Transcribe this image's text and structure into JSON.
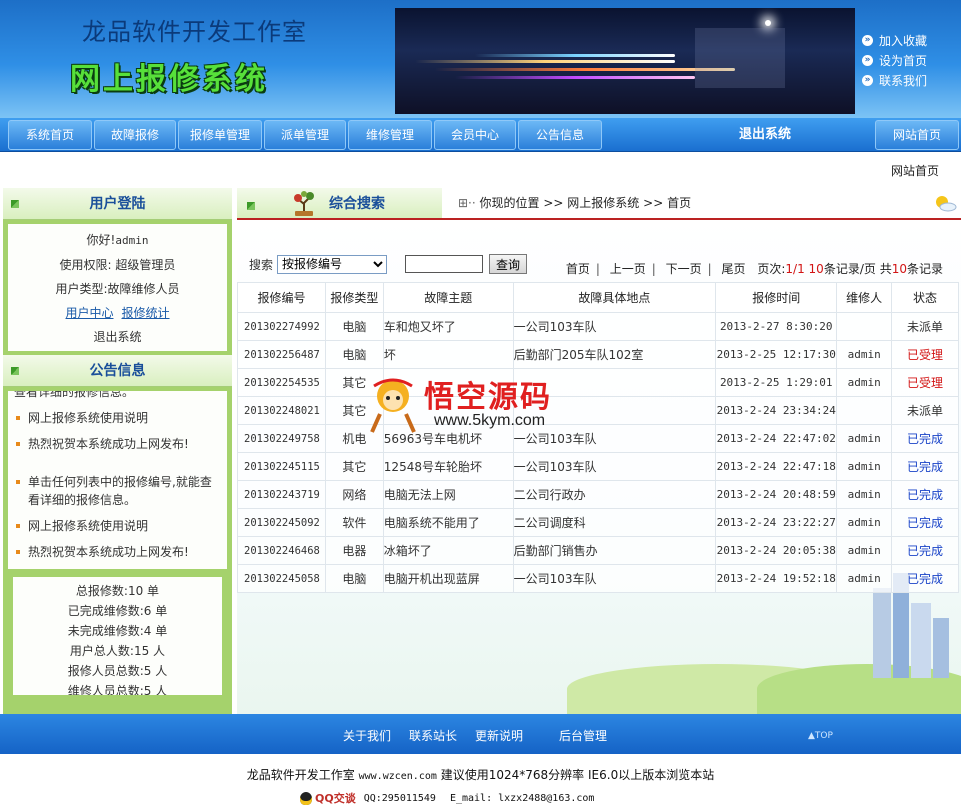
{
  "header": {
    "studio": "龙品软件开发工作室",
    "system_name": "网上报修系统",
    "links": [
      "加入收藏",
      "设为首页",
      "联系我们"
    ]
  },
  "nav": {
    "tabs": [
      "系统首页",
      "故障报修",
      "报修单管理",
      "派单管理",
      "维修管理",
      "会员中心",
      "公告信息"
    ],
    "logout": "退出系统",
    "home": "网站首页"
  },
  "top_crumb": "网站首页",
  "login_box": {
    "title": "用户登陆",
    "greeting": "你好!",
    "username": "admin",
    "permission_label": "使用权限:",
    "permission_value": "超级管理员",
    "usertype_label": "用户类型:",
    "usertype_value": "故障维修人员",
    "link_user_center": "用户中心",
    "link_stats": "报修统计",
    "logout": "退出系统"
  },
  "notice_box": {
    "title": "公告信息",
    "partial_top": "查看详细的报修信息。",
    "items": [
      "网上报修系统使用说明",
      "热烈祝贺本系统成功上网发布!"
    ],
    "desc": "单击任何列表中的报修编号,就能查看详细的报修信息。",
    "items2": [
      "网上报修系统使用说明",
      "热烈祝贺本系统成功上网发布!"
    ]
  },
  "stats": [
    {
      "label": "总报修数:",
      "value": "10 单"
    },
    {
      "label": "已完成维修数:",
      "value": "6 单"
    },
    {
      "label": "未完成维修数:",
      "value": "4 单"
    },
    {
      "label": "用户总人数:",
      "value": "15 人"
    },
    {
      "label": "报修人员总数:",
      "value": "5 人"
    },
    {
      "label": "维修人员总数:",
      "value": "5 人"
    }
  ],
  "main": {
    "title": "综合搜索",
    "location_label": "你现的位置",
    "location_1": "网上报修系统",
    "location_2": "首页",
    "arrows": ">>",
    "search_label": "搜索",
    "search_select": "按报修编号",
    "search_button": "查询",
    "pager": {
      "first": "首页",
      "prev": "上一页",
      "next": "下一页",
      "last": "尾页",
      "page_label": "页次:",
      "page_value": "1/1",
      "per_page": "10",
      "per_page_text": "条记录/页",
      "total_label": "共",
      "total": "10",
      "total_text": "条记录"
    },
    "columns": [
      "报修编号",
      "报修类型",
      "故障主题",
      "故障具体地点",
      "报修时间",
      "维修人",
      "状态"
    ],
    "rows": [
      {
        "id": "201302274992",
        "type": "电脑",
        "topic": "车和炮又坏了",
        "place": "一公司103车队",
        "time": "2013-2-27 8:30:20",
        "repairer": "",
        "status": "未派单",
        "color": "#333333"
      },
      {
        "id": "201302256487",
        "type": "电脑",
        "topic": "坏",
        "place": "后勤部门205车队102室",
        "time": "2013-2-25 12:17:30",
        "repairer": "admin",
        "status": "已受理",
        "color": "#d21414"
      },
      {
        "id": "201302254535",
        "type": "其它",
        "topic": "",
        "place": "",
        "time": "2013-2-25 1:29:01",
        "repairer": "admin",
        "status": "已受理",
        "color": "#d21414"
      },
      {
        "id": "201302248021",
        "type": "其它",
        "topic": "",
        "place": "",
        "time": "2013-2-24 23:34:24",
        "repairer": "",
        "status": "未派单",
        "color": "#333333"
      },
      {
        "id": "201302249758",
        "type": "机电",
        "topic": "56963号车电机坏",
        "place": "一公司103车队",
        "time": "2013-2-24 22:47:02",
        "repairer": "admin",
        "status": "已完成",
        "color": "#1a44c8"
      },
      {
        "id": "201302245115",
        "type": "其它",
        "topic": "12548号车轮胎坏",
        "place": "一公司103车队",
        "time": "2013-2-24 22:47:18",
        "repairer": "admin",
        "status": "已完成",
        "color": "#1a44c8"
      },
      {
        "id": "201302243719",
        "type": "网络",
        "topic": "电脑无法上网",
        "place": "二公司行政办",
        "time": "2013-2-24 20:48:59",
        "repairer": "admin",
        "status": "已完成",
        "color": "#1a44c8"
      },
      {
        "id": "201302245092",
        "type": "软件",
        "topic": "电脑系统不能用了",
        "place": "二公司调度科",
        "time": "2013-2-24 23:22:27",
        "repairer": "admin",
        "status": "已完成",
        "color": "#1a44c8"
      },
      {
        "id": "201302246468",
        "type": "电器",
        "topic": "冰箱坏了",
        "place": "后勤部门销售办",
        "time": "2013-2-24 20:05:38",
        "repairer": "admin",
        "status": "已完成",
        "color": "#1a44c8"
      },
      {
        "id": "201302245058",
        "type": "电脑",
        "topic": "电脑开机出现蓝屏",
        "place": "一公司103车队",
        "time": "2013-2-24 19:52:18",
        "repairer": "admin",
        "status": "已完成",
        "color": "#1a44c8"
      }
    ]
  },
  "watermark": {
    "title": "悟空源码",
    "url": "www.5kym.com"
  },
  "footer": {
    "links": [
      "关于我们",
      "联系站长",
      "更新说明",
      "后台管理"
    ],
    "top": "▲TOP",
    "copyright_name": "龙品软件开发工作室",
    "site": "www.wzcen.com",
    "advice": "建议使用1024*768分辨率 IE6.0以上版本浏览本站",
    "qq_badge": "QQ交谈",
    "qq": "QQ:295011549",
    "email": "E_mail: lxzx2488@163.com"
  }
}
